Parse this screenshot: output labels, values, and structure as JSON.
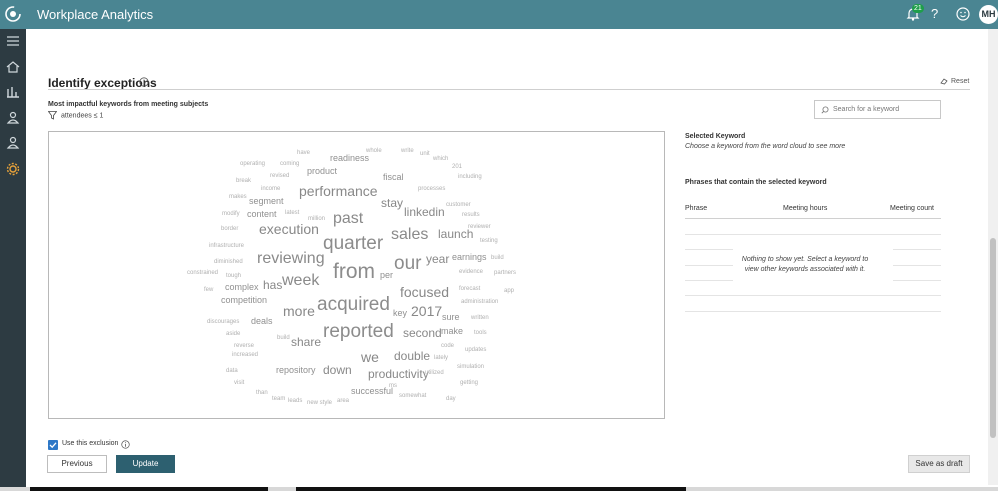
{
  "app": {
    "title": "Workplace Analytics",
    "avatar_initials": "MH",
    "notification_count": "21"
  },
  "sidebar": {
    "items": [
      "menu-icon",
      "home-icon",
      "chart-icon",
      "person-icon",
      "person-icon",
      "gear-icon"
    ]
  },
  "section": {
    "title": "Identify exceptions",
    "reset_label": "Reset",
    "subtitle": "Most impactful keywords from meeting subjects",
    "filter_label": "attendees ≤ 1",
    "search_placeholder": "Search for a keyword"
  },
  "word_cloud": {
    "words": [
      {
        "text": "have",
        "weight": 1
      },
      {
        "text": "whole",
        "weight": 1
      },
      {
        "text": "write",
        "weight": 1
      },
      {
        "text": "unit",
        "weight": 1
      },
      {
        "text": "which",
        "weight": 1
      },
      {
        "text": "readiness",
        "weight": 2
      },
      {
        "text": "operating",
        "weight": 1
      },
      {
        "text": "coming",
        "weight": 1
      },
      {
        "text": "201",
        "weight": 1
      },
      {
        "text": "product",
        "weight": 2
      },
      {
        "text": "break",
        "weight": 1
      },
      {
        "text": "revised",
        "weight": 1
      },
      {
        "text": "fiscal",
        "weight": 2
      },
      {
        "text": "including",
        "weight": 1
      },
      {
        "text": "income",
        "weight": 1
      },
      {
        "text": "processes",
        "weight": 1
      },
      {
        "text": "performance",
        "weight": 4
      },
      {
        "text": "makes",
        "weight": 1
      },
      {
        "text": "segment",
        "weight": 2
      },
      {
        "text": "customer",
        "weight": 1
      },
      {
        "text": "stay",
        "weight": 3
      },
      {
        "text": "modify",
        "weight": 1
      },
      {
        "text": "content",
        "weight": 2
      },
      {
        "text": "latest",
        "weight": 1
      },
      {
        "text": "million",
        "weight": 1
      },
      {
        "text": "linkedin",
        "weight": 3
      },
      {
        "text": "results",
        "weight": 1
      },
      {
        "text": "past",
        "weight": 5
      },
      {
        "text": "border",
        "weight": 1
      },
      {
        "text": "reviewer",
        "weight": 1
      },
      {
        "text": "execution",
        "weight": 4
      },
      {
        "text": "sales",
        "weight": 5
      },
      {
        "text": "launch",
        "weight": 3
      },
      {
        "text": "infrastructure",
        "weight": 1
      },
      {
        "text": "testing",
        "weight": 1
      },
      {
        "text": "quarter",
        "weight": 6
      },
      {
        "text": "diminished",
        "weight": 1
      },
      {
        "text": "reviewing",
        "weight": 5
      },
      {
        "text": "our",
        "weight": 6
      },
      {
        "text": "earnings",
        "weight": 2
      },
      {
        "text": "build",
        "weight": 1
      },
      {
        "text": "year",
        "weight": 3
      },
      {
        "text": "constrained",
        "weight": 1
      },
      {
        "text": "tough",
        "weight": 1
      },
      {
        "text": "week",
        "weight": 5
      },
      {
        "text": "from",
        "weight": 7
      },
      {
        "text": "per",
        "weight": 2
      },
      {
        "text": "evidence",
        "weight": 1
      },
      {
        "text": "partners",
        "weight": 1
      },
      {
        "text": "few",
        "weight": 1
      },
      {
        "text": "complex",
        "weight": 2
      },
      {
        "text": "has",
        "weight": 3
      },
      {
        "text": "forecast",
        "weight": 1
      },
      {
        "text": "competition",
        "weight": 2
      },
      {
        "text": "acquired",
        "weight": 6
      },
      {
        "text": "focused",
        "weight": 4
      },
      {
        "text": "app",
        "weight": 1
      },
      {
        "text": "administration",
        "weight": 1
      },
      {
        "text": "discourages",
        "weight": 1
      },
      {
        "text": "more",
        "weight": 4
      },
      {
        "text": "2017",
        "weight": 4
      },
      {
        "text": "key",
        "weight": 2
      },
      {
        "text": "sure",
        "weight": 2
      },
      {
        "text": "written",
        "weight": 1
      },
      {
        "text": "deals",
        "weight": 2
      },
      {
        "text": "aside",
        "weight": 1
      },
      {
        "text": "reported",
        "weight": 6
      },
      {
        "text": "second",
        "weight": 3
      },
      {
        "text": "make",
        "weight": 2
      },
      {
        "text": "tools",
        "weight": 1
      },
      {
        "text": "build",
        "weight": 1
      },
      {
        "text": "reverse",
        "weight": 1
      },
      {
        "text": "share",
        "weight": 3
      },
      {
        "text": "code",
        "weight": 1
      },
      {
        "text": "updates",
        "weight": 1
      },
      {
        "text": "increased",
        "weight": 1
      },
      {
        "text": "we",
        "weight": 4
      },
      {
        "text": "double",
        "weight": 3
      },
      {
        "text": "lately",
        "weight": 1
      },
      {
        "text": "simulation",
        "weight": 1
      },
      {
        "text": "data",
        "weight": 1
      },
      {
        "text": "repository",
        "weight": 2
      },
      {
        "text": "down",
        "weight": 3
      },
      {
        "text": "productivity",
        "weight": 3
      },
      {
        "text": "utilized",
        "weight": 1
      },
      {
        "text": "visit",
        "weight": 1
      },
      {
        "text": "getting",
        "weight": 1
      },
      {
        "text": "than",
        "weight": 1
      },
      {
        "text": "successful",
        "weight": 2
      },
      {
        "text": "team",
        "weight": 1
      },
      {
        "text": "leads",
        "weight": 1
      },
      {
        "text": "new style",
        "weight": 1
      },
      {
        "text": "area",
        "weight": 1
      },
      {
        "text": "somewhat",
        "weight": 1
      },
      {
        "text": "day",
        "weight": 1
      },
      {
        "text": "ms",
        "weight": 1
      }
    ]
  },
  "selected_keyword": {
    "title": "Selected Keyword",
    "description": "Choose a keyword from the word cloud to see more"
  },
  "phrases": {
    "title": "Phrases that contain the selected keyword",
    "columns": [
      "Phrase",
      "Meeting hours",
      "Meeting count"
    ],
    "empty_message": "Nothing to show yet. Select a keyword to view other keywords associated with it."
  },
  "footer": {
    "checkbox_label": "Use this exclusion",
    "checkbox_checked": true,
    "previous_label": "Previous",
    "update_label": "Update",
    "save_draft_label": "Save as draft"
  },
  "colors": {
    "topbar": "#4a8592",
    "sidebar": "#2d3b42",
    "primary_button": "#2d6070",
    "checkbox": "#2e78c7"
  }
}
